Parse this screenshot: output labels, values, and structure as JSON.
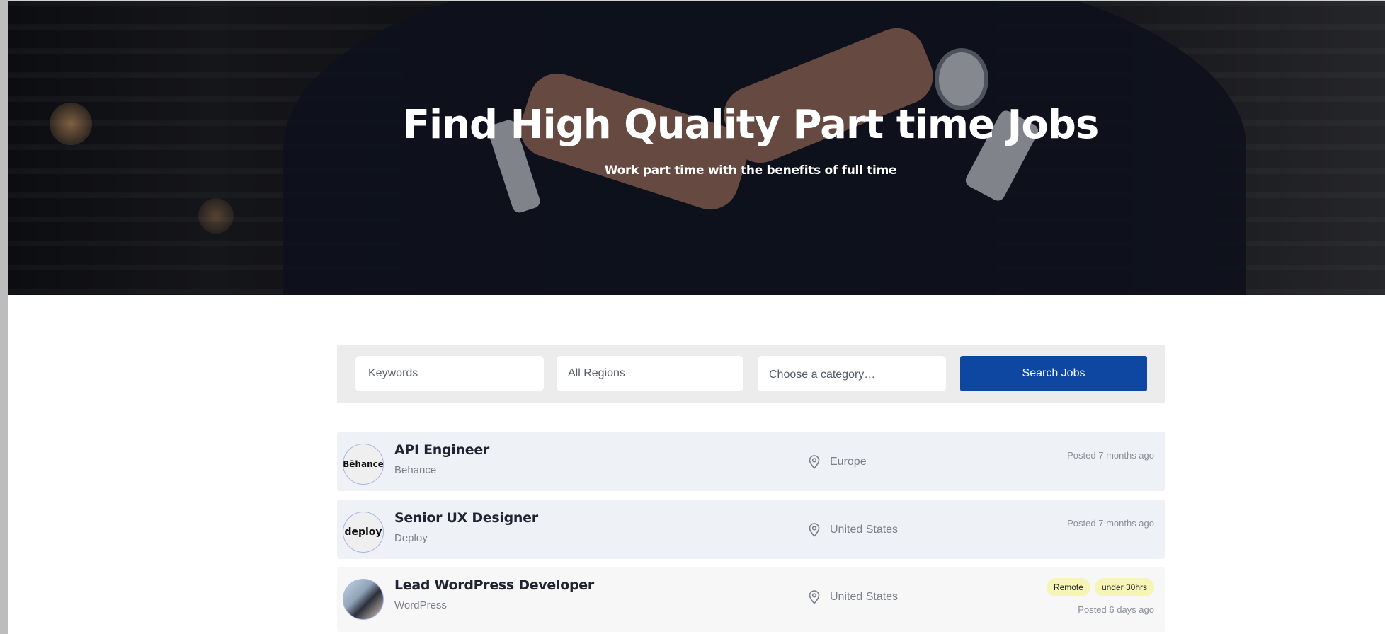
{
  "hero": {
    "title": "Find High Quality Part time Jobs",
    "subtitle": "Work part time with the benefits of full time"
  },
  "search": {
    "keywords_placeholder": "Keywords",
    "region_value": "All Regions",
    "category_value": "Choose a category…",
    "button_label": "Search Jobs",
    "button_color": "#0d47a1"
  },
  "jobs": [
    {
      "logo_text": "Bēhance",
      "title": "API Engineer",
      "company": "Behance",
      "location": "Europe",
      "posted": "Posted 7 months ago",
      "badges": []
    },
    {
      "logo_text": "deploy",
      "title": "Senior UX Designer",
      "company": "Deploy",
      "location": "United States",
      "posted": "Posted 7 months ago",
      "badges": []
    },
    {
      "logo_text": "",
      "title": "Lead WordPress Developer",
      "company": "WordPress",
      "location": "United States",
      "posted": "Posted 6 days ago",
      "badges": [
        "Remote",
        "under 30hrs"
      ]
    }
  ],
  "colors": {
    "badge_bg": "#f6f5b5",
    "row_bg": "#eef2f7",
    "title_text": "#1f2430"
  },
  "icons": {
    "location": "map-pin-icon"
  }
}
